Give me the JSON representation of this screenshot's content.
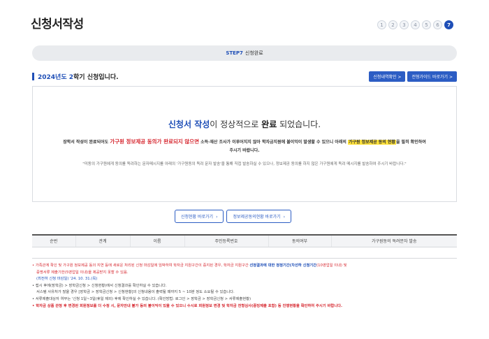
{
  "header": {
    "title": "신청서작성",
    "steps": [
      "1",
      "2",
      "3",
      "4",
      "5",
      "6",
      "7"
    ],
    "active_step": 7
  },
  "step_bar": {
    "step": "STEP7",
    "label": "신청완료"
  },
  "sub_heading": {
    "year": "2024년도",
    "term": "2",
    "rest": "학기 신청입니다."
  },
  "top_buttons": {
    "result_btn": "신청내역확인 >",
    "guide_btn": "전형가이드 바로가기 >"
  },
  "notice": {
    "main_part1": "신청서 작성",
    "main_part2": "이 정상적으로 ",
    "main_part3": "완료",
    "main_part4": " 되었습니다.",
    "desc_part1": "장학서 작성이 완료되어도 ",
    "desc_red": "가구원 정보제공 동의가 완료되지 않으면",
    "desc_part2": " 소득·재산 조사가 이루어지지 않아 학자금지원에 불이익이 발생할 수 있으니 아래의 ",
    "desc_yellow": "가구원 정보제공 동의 현황",
    "desc_part3": "을 필히 확인하여 주시기 바랍니다.",
    "quote": "\"미동의 가구원에게 동의를 독려하는 문자메시지를 아래의 '가구원동의 독려 문자 발송'을 통해 직접 발송하실 수 있으나, 정보제공 동의를 하지 않은 가구원에게 독려 메시지를 발송하여 주시기 바랍니다.\""
  },
  "mid_buttons": {
    "result": "신청현황 바로가기",
    "consent": "정보제공동의현황 바로가기"
  },
  "table": {
    "headers": [
      "순번",
      "관계",
      "이름",
      "주민등록번호",
      "동의여부",
      "가구원동의 독려문자 발송"
    ]
  },
  "notes": {
    "n1_a": "• 가족관계 확인 및 가구원 정보제공 동의 지연 등에 새로운 처리된 신청 마감일에 임박하여 학자금 지원구간이 증지된 경우, 학자금 지원구간 ",
    "n1_blue": "선정결과에 대한 정정기간(차선하 신청기간",
    "n1_b": "(10영업일 이내) 및",
    "n1_c": "증명서류 제출기한(5영업일 이내)을 제공받지 못할 수 있음.",
    "n1_d": "(최전하 신청 마감일) '24. 10. 31.(목)",
    "n2": "• 접시 후에(장학금) > 장학금신청 > 신청현황)에서 신청결과를 확인하실 수 있습니다.",
    "n2_sub": "서스템 사유처가 많을 경우 [장학금 > 장학금신청 > 신청현황]의 신청내용이 출력될 때까지 5 ~ 10분 정도 소요될 수 있습니다.",
    "n3": "• 서류제출대상자 여부는 '신청 1일~3일(휴일 제외) 후에 확인하실 수 있습니다. (확인방법: 로그인 > 장학금 > 장학금신청 > 서류제출현황)",
    "n4": "• 학자금 상품 관청 후 변경된 회원정보를 더 수정 시, 문자안내 불가 등의 불이익이 있을 수 있으니 수시로 회원정보 변경 및 학자금 전형심사(증빙제출 포함) 등 진행현황을 확인하여 주시기 바랍니다."
  },
  "colors": {
    "primary": "#1f4fb7",
    "red": "#d6272f",
    "highlight": "#ffe23a"
  }
}
